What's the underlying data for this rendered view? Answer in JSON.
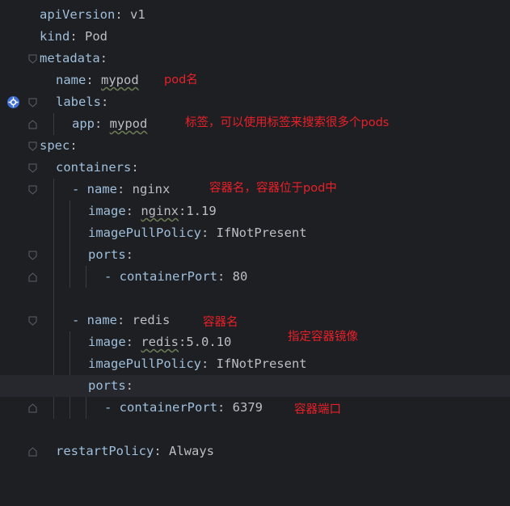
{
  "editor": {
    "lines": {
      "l1": {
        "key": "apiVersion",
        "sep": ": ",
        "val": "v1"
      },
      "l2": {
        "key": "kind",
        "sep": ": ",
        "val": "Pod"
      },
      "l3": {
        "key": "metadata",
        "sep": ":"
      },
      "l4": {
        "key": "name",
        "sep": ": ",
        "val": "mypod"
      },
      "l5": {
        "key": "labels",
        "sep": ":"
      },
      "l6": {
        "key": "app",
        "sep": ": ",
        "val": "mypod"
      },
      "l7": {
        "key": "spec",
        "sep": ":"
      },
      "l8": {
        "key": "containers",
        "sep": ":"
      },
      "l9": {
        "dash": "- ",
        "key": "name",
        "sep": ": ",
        "val": "nginx"
      },
      "l10": {
        "key": "image",
        "sep": ": ",
        "val_a": "nginx",
        "val_b": ":1.19"
      },
      "l11": {
        "key": "imagePullPolicy",
        "sep": ": ",
        "val": "IfNotPresent"
      },
      "l12": {
        "key": "ports",
        "sep": ":"
      },
      "l13": {
        "dash": "- ",
        "key": "containerPort",
        "sep": ": ",
        "val": "80"
      },
      "l15": {
        "dash": "- ",
        "key": "name",
        "sep": ": ",
        "val": "redis"
      },
      "l16": {
        "key": "image",
        "sep": ": ",
        "val_a": "redis",
        "val_b": ":5.0.10"
      },
      "l17": {
        "key": "imagePullPolicy",
        "sep": ": ",
        "val": "IfNotPresent"
      },
      "l18": {
        "key": "ports",
        "sep": ":"
      },
      "l19": {
        "dash": "- ",
        "key": "containerPort",
        "sep": ": ",
        "val": "6379"
      },
      "l21": {
        "key": "restartPolicy",
        "sep": ": ",
        "val": "Always"
      }
    },
    "annotations": {
      "pod_name": "pod名",
      "labels": "标签，可以使用标签来搜索很多个pods",
      "container_name": "容器名，容器位于pod中",
      "container_name2": "容器名",
      "image": "指定容器镜像",
      "port": "容器端口"
    },
    "colors": {
      "background": "#1e1f22",
      "key": "#9fbfdc",
      "value": "#bcbec4",
      "annotation": "#e8202a",
      "current_line": "#26282e"
    }
  }
}
